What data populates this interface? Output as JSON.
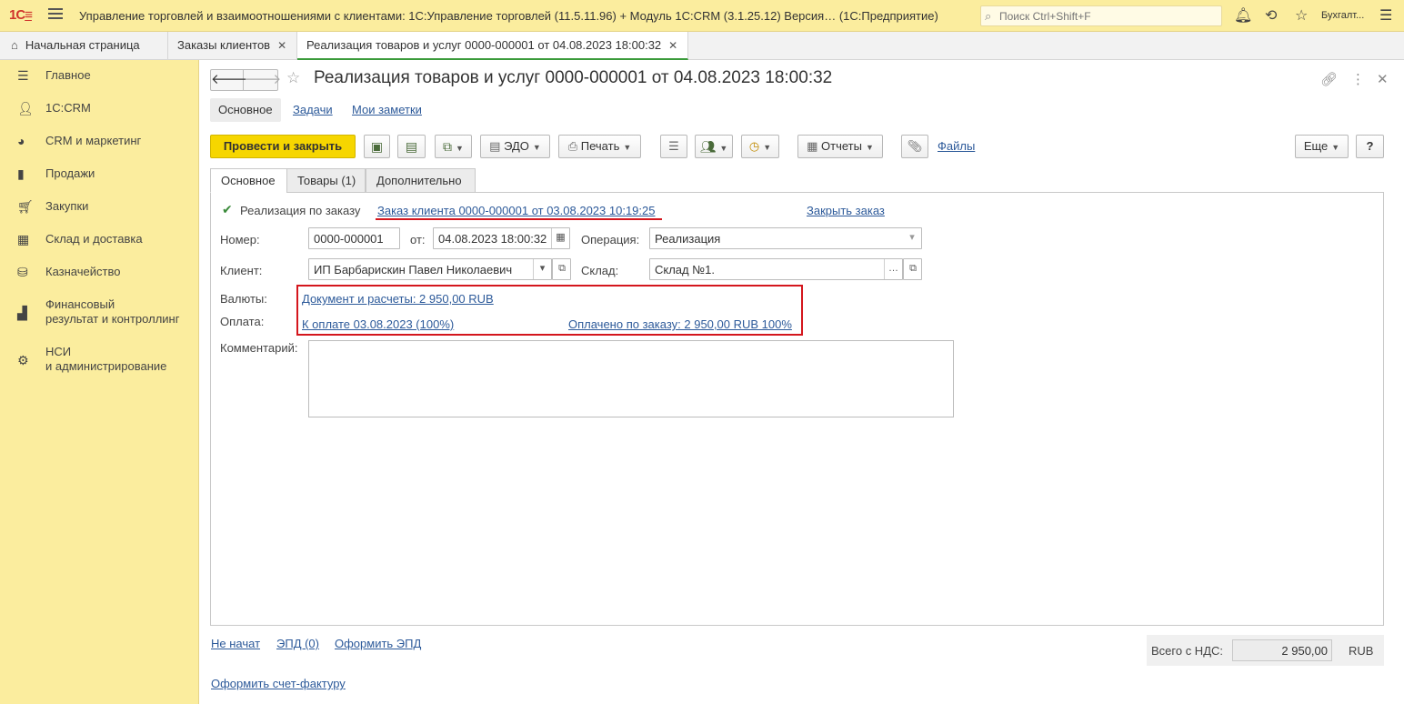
{
  "app": {
    "logo": "1С",
    "title": "Управление торговлей и взаимоотношениями с клиентами: 1С:Управление торговлей (11.5.11.96) + Модуль 1С:CRM (3.1.25.12) Версия…  (1С:Предприятие)",
    "search_placeholder": "Поиск Ctrl+Shift+F",
    "user": "Бухгалт..."
  },
  "tabs": [
    {
      "label": "Начальная страница"
    },
    {
      "label": "Заказы клиентов",
      "close": "✕"
    },
    {
      "label": "Реализация товаров и услуг 0000-000001 от 04.08.2023 18:00:32",
      "close": "✕"
    }
  ],
  "sidebar": {
    "items": [
      {
        "label": "Главное",
        "icon": "menu-lines-icon"
      },
      {
        "label": "1С:CRM",
        "icon": "users-icon"
      },
      {
        "label": "CRM и маркетинг",
        "icon": "pie-chart-icon"
      },
      {
        "label": "Продажи",
        "icon": "shopping-bag-icon"
      },
      {
        "label": "Закупки",
        "icon": "cart-icon"
      },
      {
        "label": "Склад и доставка",
        "icon": "grid-icon"
      },
      {
        "label": "Казначейство",
        "icon": "coins-icon"
      },
      {
        "label": "Финансовый\nрезультат и контроллинг",
        "line1": "Финансовый",
        "line2": "результат и контроллинг",
        "icon": "bar-chart-icon"
      },
      {
        "label": "НСИ\nи администрирование",
        "line1": "НСИ",
        "line2": "и администрирование",
        "icon": "gear-icon"
      }
    ]
  },
  "document": {
    "title": "Реализация товаров и услуг 0000-000001 от 04.08.2023 18:00:32",
    "subtabs": [
      "Основное",
      "Задачи",
      "Мои заметки"
    ],
    "toolbar": {
      "post_and_close": "Провести и закрыть",
      "edo": "ЭДО",
      "print": "Печать",
      "reports": "Отчеты",
      "files": "Файлы",
      "more": "Еще",
      "help": "?"
    },
    "form_tabs": [
      "Основное",
      "Товары (1)",
      "Дополнительно"
    ],
    "by_order_label": "Реализация по заказу",
    "by_order_checked": true,
    "order_link": "Заказ клиента 0000-000001 от 03.08.2023 10:19:25",
    "close_order_link": "Закрыть заказ",
    "number_label": "Номер:",
    "number_value": "0000-000001",
    "from_label": "от:",
    "date_value": "04.08.2023 18:00:32",
    "operation_label": "Операция:",
    "operation_value": "Реализация",
    "client_label": "Клиент:",
    "client_value": "ИП Барбарискин Павел Николаевич",
    "warehouse_label": "Склад:",
    "warehouse_value": "Склад №1.",
    "currency_label": "Валюты:",
    "currency_link": "Документ и расчеты: 2 950,00 RUB",
    "payment_label": "Оплата:",
    "payment_link": "К оплате 03.08.2023 (100%)",
    "paid_link": "Оплачено по заказу: 2 950,00 RUB 100%",
    "comment_label": "Комментарий:",
    "comment_value": ""
  },
  "footer": {
    "not_started": "Не начат",
    "epd": "ЭПД (0)",
    "make_epd": "Оформить ЭПД",
    "make_invoice": "Оформить счет-фактуру",
    "total_label": "Всего с НДС:",
    "total_value": "2 950,00",
    "currency": "RUB"
  },
  "colors": {
    "sidebar_bg": "#fbed9e",
    "primary_button": "#f6d600",
    "link": "#2d5a9a",
    "highlight_red": "#d4161d",
    "active_tab_accent": "#3a9a3a"
  }
}
